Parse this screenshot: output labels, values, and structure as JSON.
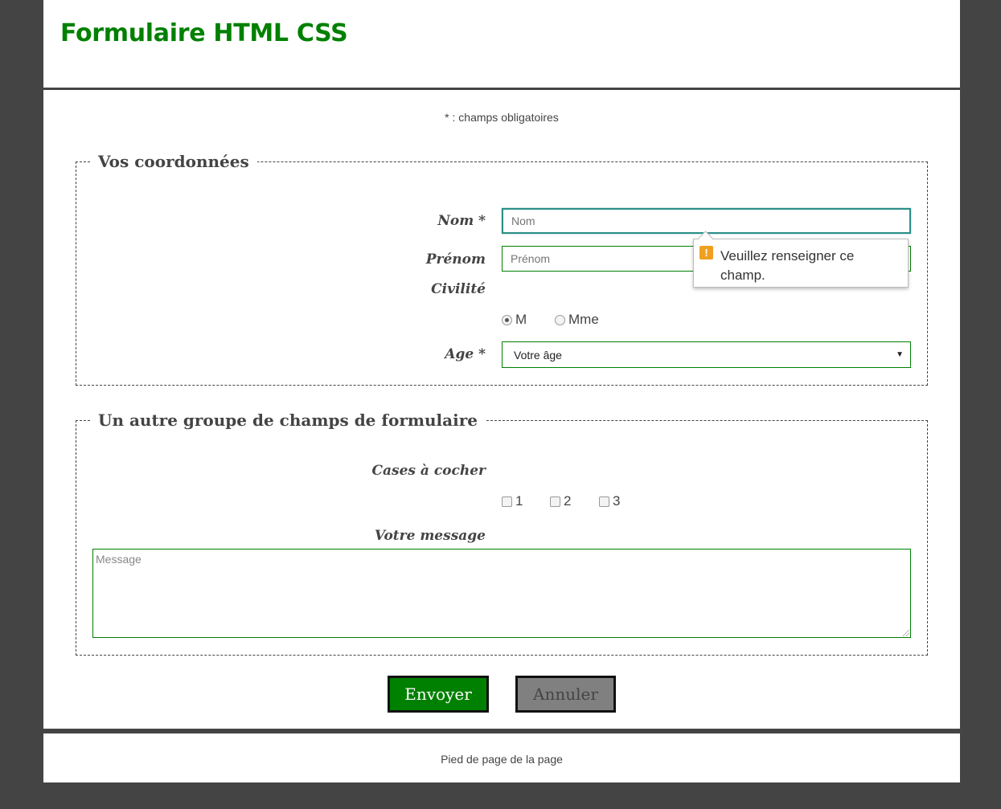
{
  "header": {
    "title": "Formulaire HTML CSS"
  },
  "required_note": "* : champs obligatoires",
  "group1": {
    "legend": "Vos coordonnées",
    "nom_label": "Nom *",
    "nom_placeholder": "Nom",
    "prenom_label": "Prénom",
    "prenom_placeholder": "Prénom",
    "civilite_label": "Civilité",
    "civilite_options": [
      {
        "label": "M",
        "checked": true
      },
      {
        "label": "Mme",
        "checked": false
      }
    ],
    "age_label": "Age *",
    "age_selected": "Votre âge"
  },
  "tooltip": {
    "text": "Veuillez renseigner ce champ.",
    "icon": "warning-icon"
  },
  "group2": {
    "legend": "Un autre groupe de champs de formulaire",
    "checkbox_label": "Cases à cocher",
    "checkbox_options": [
      "1",
      "2",
      "3"
    ],
    "message_label": "Votre message",
    "message_placeholder": "Message"
  },
  "buttons": {
    "send": "Envoyer",
    "cancel": "Annuler"
  },
  "footer": {
    "text": "Pied de page de la page"
  },
  "colors": {
    "accent": "#008000",
    "frame": "#444444",
    "cancel": "#808080",
    "warning": "#f0a020"
  }
}
